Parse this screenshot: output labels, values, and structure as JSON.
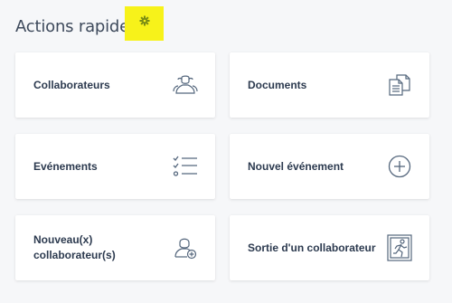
{
  "header": {
    "title": "Actions rapides"
  },
  "icons": {
    "settings": "gear-icon"
  },
  "colors": {
    "icon_stroke": "#55677d",
    "highlight": "#f7f21a",
    "gear": "#7a8c14"
  },
  "cards": [
    {
      "label": "Collaborateurs",
      "icon": "users-icon"
    },
    {
      "label": "Documents",
      "icon": "documents-icon"
    },
    {
      "label": "Evénements",
      "icon": "checklist-icon"
    },
    {
      "label": "Nouvel événement",
      "icon": "plus-circle-icon"
    },
    {
      "label": "Nouveau(x)\ncollaborateur(s)",
      "icon": "add-user-icon"
    },
    {
      "label": "Sortie d'un collaborateur",
      "icon": "exit-icon"
    }
  ]
}
